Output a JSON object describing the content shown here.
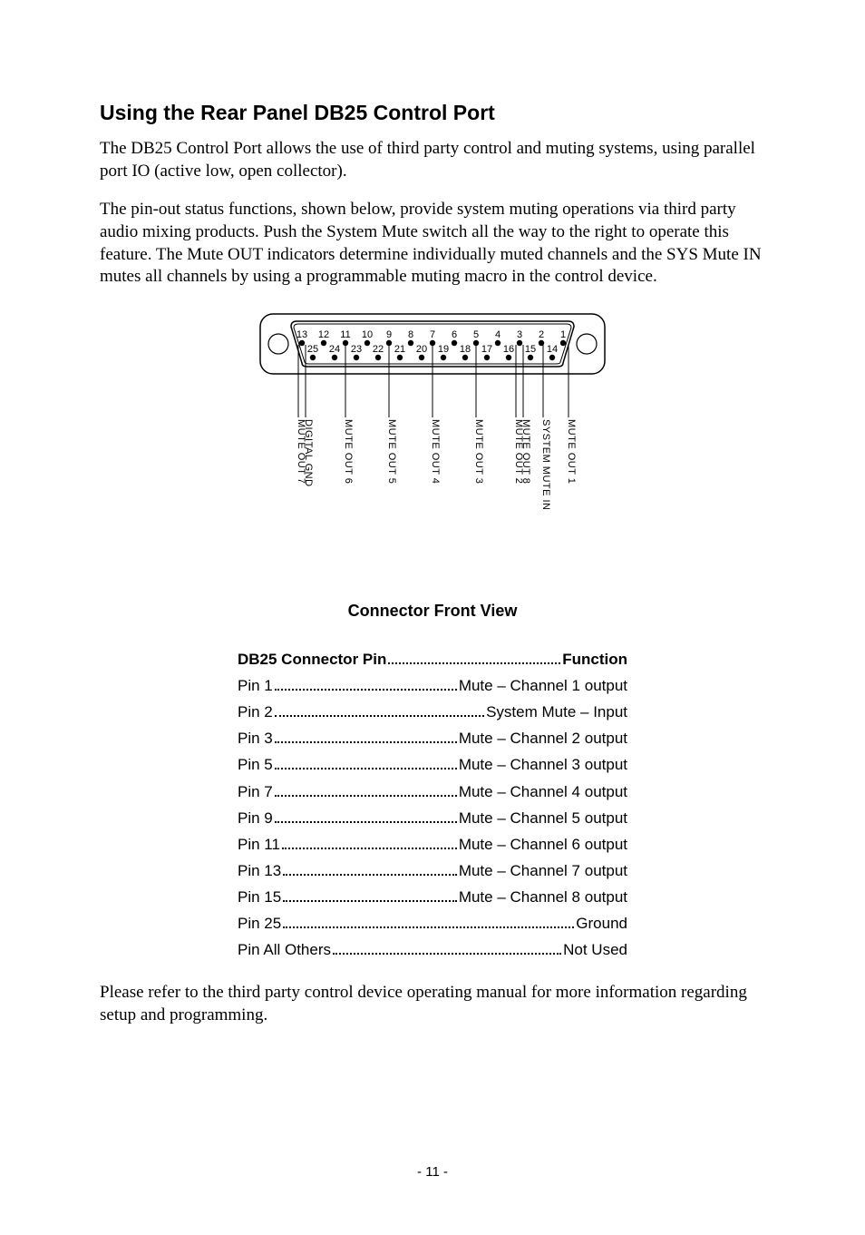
{
  "heading": "Using the Rear Panel DB25 Control Port",
  "para1": "The DB25 Control Port allows the use of third party control and muting systems, using parallel port IO (active low, open collector).",
  "para2": "The pin-out status functions, shown below, provide system muting operations via third party audio mixing products. Push the System Mute switch all the way to the right to operate this feature. The Mute OUT indicators determine individually muted channels and the SYS Mute IN mutes all channels by using a programmable muting macro in the control device.",
  "figure": {
    "top_numbers": [
      "13",
      "12",
      "11",
      "10",
      "9",
      "8",
      "7",
      "6",
      "5",
      "4",
      "3",
      "2",
      "1"
    ],
    "bottom_numbers": [
      "25",
      "24",
      "23",
      "22",
      "21",
      "20",
      "19",
      "18",
      "17",
      "16",
      "15",
      "14"
    ],
    "caption": "Connector Front View",
    "callouts": [
      {
        "pin_top_index": 0,
        "offset": -4,
        "text": "MUTE  OUT 7"
      },
      {
        "pin_top_index": 0,
        "offset": 4,
        "text": "DIGITAL  GND"
      },
      {
        "pin_top_index": 2,
        "offset": 0,
        "text": "MUTE  OUT 6"
      },
      {
        "pin_top_index": 4,
        "offset": 0,
        "text": "MUTE  OUT 5"
      },
      {
        "pin_top_index": 6,
        "offset": 0,
        "text": "MUTE  OUT 4"
      },
      {
        "pin_top_index": 8,
        "offset": 0,
        "text": "MUTE  OUT 3"
      },
      {
        "pin_top_index": 10,
        "offset": -4,
        "text": "MUTE  OUT 2"
      },
      {
        "pin_top_index": 10,
        "offset": 4,
        "text": "MUTE  OUT 8"
      },
      {
        "pin_top_index": 11,
        "offset": 2,
        "text": "SYSTEM  MUTE  IN"
      },
      {
        "pin_top_index": 12,
        "offset": 6,
        "text": "MUTE  OUT 1"
      }
    ]
  },
  "pin_header": {
    "pin": "DB25 Connector Pin",
    "func": "Function"
  },
  "pins": [
    {
      "pin": "Pin 1",
      "func": "Mute – Channel 1 output"
    },
    {
      "pin": "Pin 2",
      "func": "System Mute – Input"
    },
    {
      "pin": "Pin 3",
      "func": "Mute – Channel 2 output"
    },
    {
      "pin": "Pin 5",
      "func": "Mute – Channel 3 output"
    },
    {
      "pin": "Pin 7",
      "func": "Mute – Channel 4 output"
    },
    {
      "pin": "Pin 9",
      "func": "Mute – Channel 5 output"
    },
    {
      "pin": "Pin 11",
      "func": "Mute – Channel 6 output"
    },
    {
      "pin": "Pin 13",
      "func": "Mute – Channel 7 output"
    },
    {
      "pin": "Pin 15",
      "func": "Mute – Channel 8 output"
    },
    {
      "pin": "Pin 25",
      "func": "Ground"
    },
    {
      "pin": "Pin All Others",
      "func": "Not Used"
    }
  ],
  "closing": "Please refer to the third party control device operating manual for more information regarding setup and programming.",
  "page_number": "- 11 -"
}
